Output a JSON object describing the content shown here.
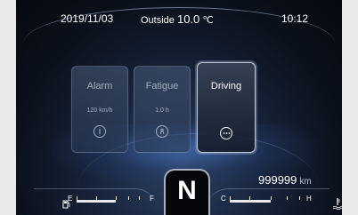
{
  "header": {
    "date": "2019/11/03",
    "outside_label": "Outside",
    "outside_value": "10.0",
    "outside_unit": "℃",
    "time": "10:12"
  },
  "cards": [
    {
      "title": "Alarm",
      "sub": "120 km/h",
      "icon": "power-icon"
    },
    {
      "title": "Fatigue",
      "sub": "1.0 h",
      "icon": "driver-icon"
    },
    {
      "title": "Driving",
      "sub": "",
      "icon": "more-icon"
    }
  ],
  "odometer": {
    "value": "999999",
    "unit": "km"
  },
  "gear": "N",
  "fuel": {
    "empty_label": "E",
    "full_label": "F",
    "icon": "fuel-pump-icon"
  },
  "temperature": {
    "cold_label": "C",
    "hot_label": "H",
    "icon": "coolant-temp-icon"
  },
  "colors": {
    "accent": "#2b3f63",
    "background": "#06090f",
    "text": "#ffffff"
  }
}
